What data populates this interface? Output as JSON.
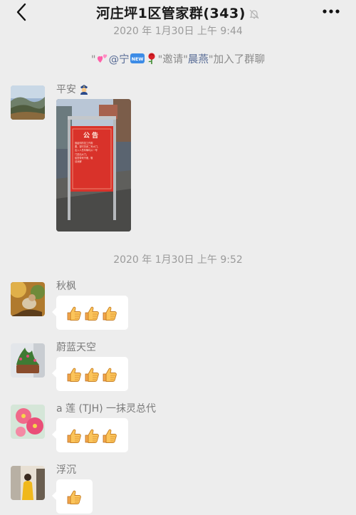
{
  "header": {
    "title": "河庄坪1区管家群(343)"
  },
  "timestamps": [
    "2020 年 1月30日 上午 9:44",
    "2020 年 1月30日 上午 9:52"
  ],
  "system_notice": {
    "open_quote": "\"",
    "inviter_prefix": "@宁",
    "middle": "\"邀请\"",
    "invitee": "晨燕",
    "suffix": "\"加入了群聊",
    "icons": [
      "two-hearts-emoji",
      "new-badge-emoji",
      "rose-emoji"
    ]
  },
  "messages": [
    {
      "sender": "平安",
      "sender_icon": "police-officer-emoji",
      "type": "image",
      "image": {
        "sign_title": "公告",
        "sign_text": [
          "因疫情防控工作需",
          "要，暂时关闭二号大门，",
          "出入人员车辆均从一号",
          "门进出大门。",
          "给您带来不便，敬",
          "请谅解"
        ]
      }
    },
    {
      "sender": "秋枫",
      "type": "emoji",
      "thumbs": 3
    },
    {
      "sender": "蔚蓝天空",
      "type": "emoji",
      "thumbs": 3
    },
    {
      "sender": "a 莲 (TJH) 一抹灵总代",
      "type": "emoji",
      "thumbs": 3
    },
    {
      "sender": "浮沉",
      "type": "emoji",
      "thumbs": 1
    }
  ],
  "colors": {
    "background": "#ededed",
    "bubble": "#ffffff",
    "link": "#576b95",
    "timestamp": "#9a9a9a",
    "sign": "#d9322a"
  }
}
